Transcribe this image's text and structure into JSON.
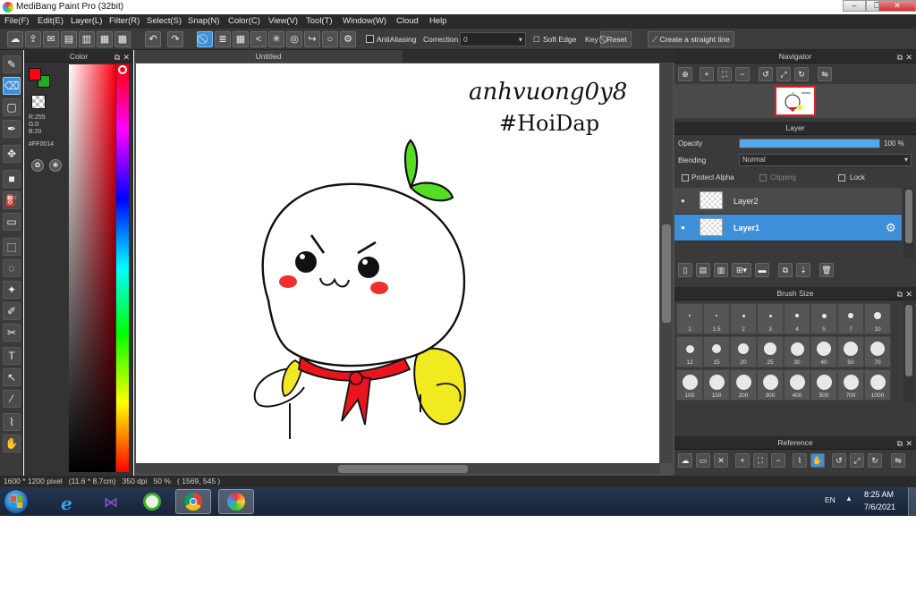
{
  "window": {
    "title": "MediBang Paint Pro (32bit)"
  },
  "menu": [
    "File(F)",
    "Edit(E)",
    "Layer(L)",
    "Filter(R)",
    "Select(S)",
    "Snap(N)",
    "Color(C)",
    "View(V)",
    "Tool(T)",
    "Window(W)",
    "Cloud",
    "Help"
  ],
  "toolbar": {
    "antialiasing_label": "AntiAliasing",
    "correction_label": "Correction",
    "correction_value": "0",
    "soft_edge_label": "Soft Edge",
    "key_label": "Key",
    "reset_label": "Reset",
    "straight_line_label": "Create a straight line"
  },
  "color_panel": {
    "title": "Color",
    "rgb_r": "R:255",
    "rgb_g": "G:0",
    "rgb_b": "B:20",
    "hex": "#FF0014",
    "foreground": "#FF0014",
    "background": "#22AA22"
  },
  "document": {
    "tab_title": "Untitled"
  },
  "artwork": {
    "line1": "anhvuong0y8",
    "line2": "#HoiDap"
  },
  "navigator": {
    "title": "Navigator"
  },
  "layer_panel": {
    "title": "Layer",
    "opacity_label": "Opacity",
    "opacity_value": "100 %",
    "opacity_fraction": 1.0,
    "blending_label": "Blending",
    "blending_value": "Normal",
    "protect_alpha_label": "Protect Alpha",
    "clipping_label": "Clipping",
    "lock_label": "Lock",
    "layers": [
      {
        "name": "Layer2",
        "selected": false
      },
      {
        "name": "Layer1",
        "selected": true
      }
    ]
  },
  "brush_size": {
    "title": "Brush Size",
    "sizes": [
      "1",
      "1.5",
      "2",
      "3",
      "4",
      "5",
      "7",
      "10",
      "12",
      "15",
      "20",
      "25",
      "30",
      "40",
      "50",
      "70",
      "100",
      "150",
      "200",
      "300",
      "400",
      "500",
      "700",
      "1000"
    ]
  },
  "reference": {
    "title": "Reference"
  },
  "status": {
    "text": "1600 * 1200 pixel   (11.6 * 8.7cm)   350 dpi   50 %   ( 1569, 545 )"
  },
  "taskbar": {
    "language": "EN",
    "time": "8:25 AM",
    "date": "7/6/2021"
  }
}
